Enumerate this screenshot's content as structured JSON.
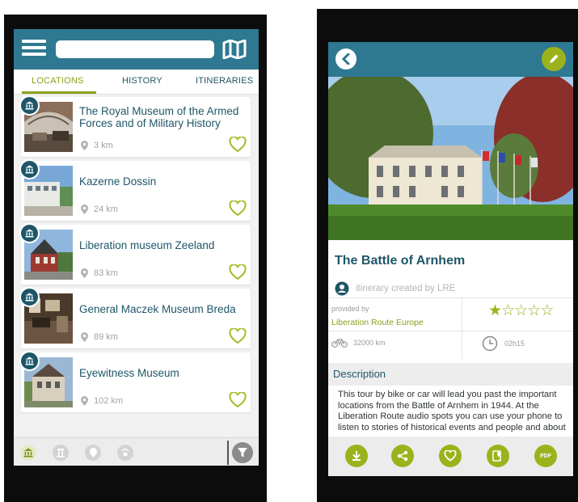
{
  "left": {
    "search": {
      "placeholder": ""
    },
    "tabs": [
      "LOCATIONS",
      "HISTORY",
      "ITINERARIES"
    ],
    "locations": [
      {
        "title": "The Royal Museum of the Armed Forces and of Military History",
        "distance": "3 km"
      },
      {
        "title": "Kazerne Dossin",
        "distance": "24 km"
      },
      {
        "title": "Liberation museum Zeeland",
        "distance": "83 km"
      },
      {
        "title": "General Maczek Museum Breda",
        "distance": "89 km"
      },
      {
        "title": "Eyewitness Museum",
        "distance": "102 km"
      }
    ],
    "bottom_icons": [
      "museum-icon",
      "monument-icon",
      "location-pin-icon",
      "audio-spot-icon",
      "filter-icon"
    ]
  },
  "right": {
    "title": "The Battle of Arnhem",
    "creator": "itinerary created by LRE",
    "provided_by_label": "provided by",
    "provider": "Liberation Route Europe",
    "rating": 1,
    "rating_max": 5,
    "distance": "32000 km",
    "duration": "02h15",
    "description_heading": "Description",
    "description": "This tour by bike or car will lead you past the important locations from the Battle of Arnhem in 1944. At the Liberation Route audio spots you can use your phone to listen to stories of historical events and people and about the",
    "actions": [
      "download-icon",
      "share-icon",
      "heart-icon",
      "map-book-icon",
      "pdf-icon"
    ],
    "pdf_label": "PDF"
  },
  "colors": {
    "header": "#2e7891",
    "accent": "#9cb21c",
    "title_text": "#1e5668"
  }
}
